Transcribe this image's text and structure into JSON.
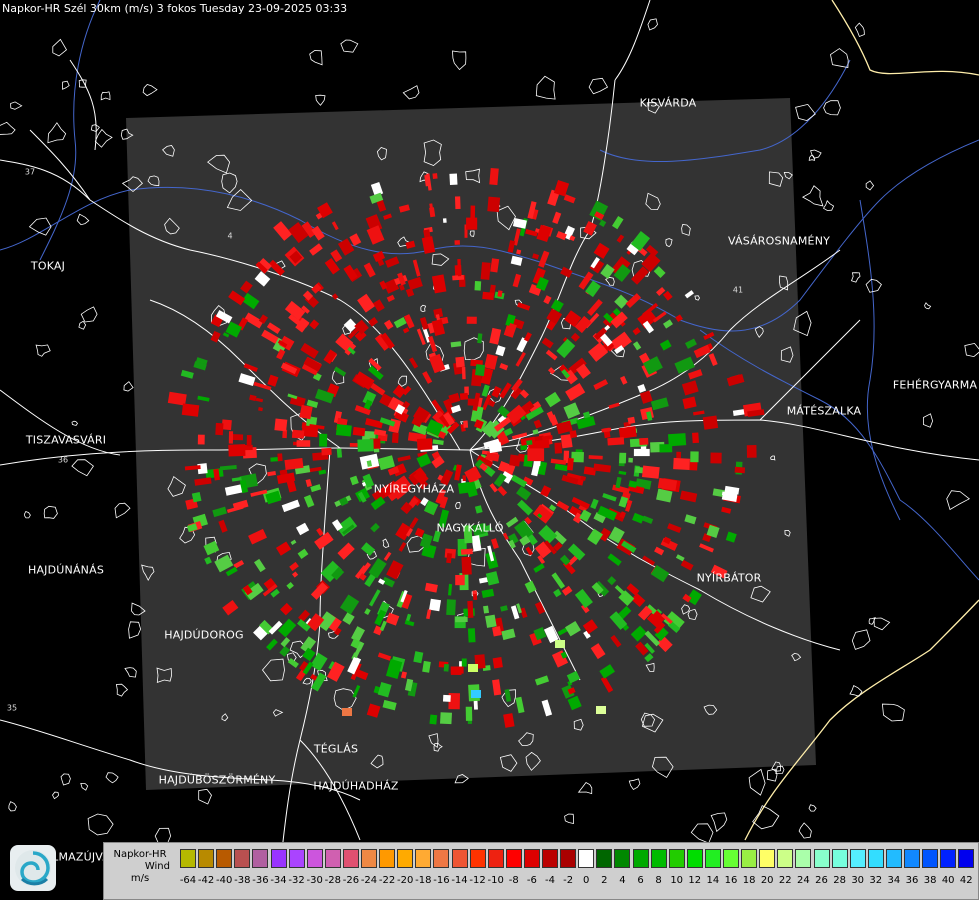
{
  "header": {
    "title": "Napkor-HR Szél 30km (m/s) 3 fokos Tuesday 23-09-2025 03:33"
  },
  "cities": [
    {
      "id": "kisvarda",
      "name": "KISVÁRDA"
    },
    {
      "id": "vasarosnameny",
      "name": "VÁSÁROSNAMÉNY"
    },
    {
      "id": "tokaj",
      "name": "TOKAJ"
    },
    {
      "id": "fehergyarmat",
      "name": "FEHÉRGYARMA"
    },
    {
      "id": "mateszalka",
      "name": "MÁTÉSZALKA"
    },
    {
      "id": "tiszavasvari",
      "name": "TISZAVASVÁRI"
    },
    {
      "id": "nyiregyhaza",
      "name": "NYÍREGYHÁZA"
    },
    {
      "id": "nagykallo",
      "name": "NAGYKÁLLÓ"
    },
    {
      "id": "hajdunanas",
      "name": "HAJDÚNÁNÁS"
    },
    {
      "id": "nyirbator",
      "name": "NYÍRBÁTOR"
    },
    {
      "id": "hajdudorog",
      "name": "HAJDÚDOROG"
    },
    {
      "id": "teglas",
      "name": "TÉGLÁS"
    },
    {
      "id": "hajduboszormeny",
      "name": "HAJDÚBÖSZÖRMÉNY"
    },
    {
      "id": "hajduhadhaz",
      "name": "HAJDÚHADHÁZ"
    },
    {
      "id": "balmazujvaros",
      "name": "LMAZÚJVÁR"
    }
  ],
  "road_numbers": [
    "37",
    "4",
    "41",
    "36",
    "35"
  ],
  "legend": {
    "product": "Napkor-HR",
    "quantity": "Wind",
    "unit": "m/s",
    "bins": [
      {
        "value": -64,
        "color": "#b5b800"
      },
      {
        "value": -42,
        "color": "#b88a00"
      },
      {
        "value": -40,
        "color": "#b85a00"
      },
      {
        "value": -38,
        "color": "#b85050"
      },
      {
        "value": -36,
        "color": "#b060a0"
      },
      {
        "value": -34,
        "color": "#9933ff"
      },
      {
        "value": -32,
        "color": "#aa44ff"
      },
      {
        "value": -30,
        "color": "#cc55dd"
      },
      {
        "value": -28,
        "color": "#d060b0"
      },
      {
        "value": -26,
        "color": "#e05070"
      },
      {
        "value": -24,
        "color": "#ee8844"
      },
      {
        "value": -22,
        "color": "#ff9900"
      },
      {
        "value": -20,
        "color": "#ffaa00"
      },
      {
        "value": -18,
        "color": "#ffaa33"
      },
      {
        "value": -16,
        "color": "#ee7744"
      },
      {
        "value": -14,
        "color": "#ee5533"
      },
      {
        "value": -12,
        "color": "#ff3300"
      },
      {
        "value": -10,
        "color": "#ee2211"
      },
      {
        "value": -8,
        "color": "#ff0000"
      },
      {
        "value": -6,
        "color": "#dd0000"
      },
      {
        "value": -4,
        "color": "#bb0000"
      },
      {
        "value": -2,
        "color": "#aa0000"
      },
      {
        "value": 0,
        "color": "#ffffff"
      },
      {
        "value": 2,
        "color": "#006600"
      },
      {
        "value": 4,
        "color": "#008800"
      },
      {
        "value": 6,
        "color": "#00aa00"
      },
      {
        "value": 8,
        "color": "#00bb00"
      },
      {
        "value": 10,
        "color": "#22cc00"
      },
      {
        "value": 12,
        "color": "#00dd00"
      },
      {
        "value": 14,
        "color": "#22ee22"
      },
      {
        "value": 16,
        "color": "#66ff33"
      },
      {
        "value": 18,
        "color": "#99ee44"
      },
      {
        "value": 20,
        "color": "#ffff66"
      },
      {
        "value": 22,
        "color": "#ccff88"
      },
      {
        "value": 24,
        "color": "#aaffaa"
      },
      {
        "value": 26,
        "color": "#88ffcc"
      },
      {
        "value": 28,
        "color": "#77ffdd"
      },
      {
        "value": 30,
        "color": "#55eeff"
      },
      {
        "value": 32,
        "color": "#33ddff"
      },
      {
        "value": 34,
        "color": "#22bbff"
      },
      {
        "value": 36,
        "color": "#1188ff"
      },
      {
        "value": 38,
        "color": "#0055ff"
      },
      {
        "value": 40,
        "color": "#0022ff"
      },
      {
        "value": 42,
        "color": "#0000ee"
      }
    ]
  },
  "colors": {
    "background": "#000000",
    "radar_footprint": "#333333",
    "roads": "#ffffff",
    "rivers": "#4466cc",
    "border": "#ffeeaa"
  }
}
